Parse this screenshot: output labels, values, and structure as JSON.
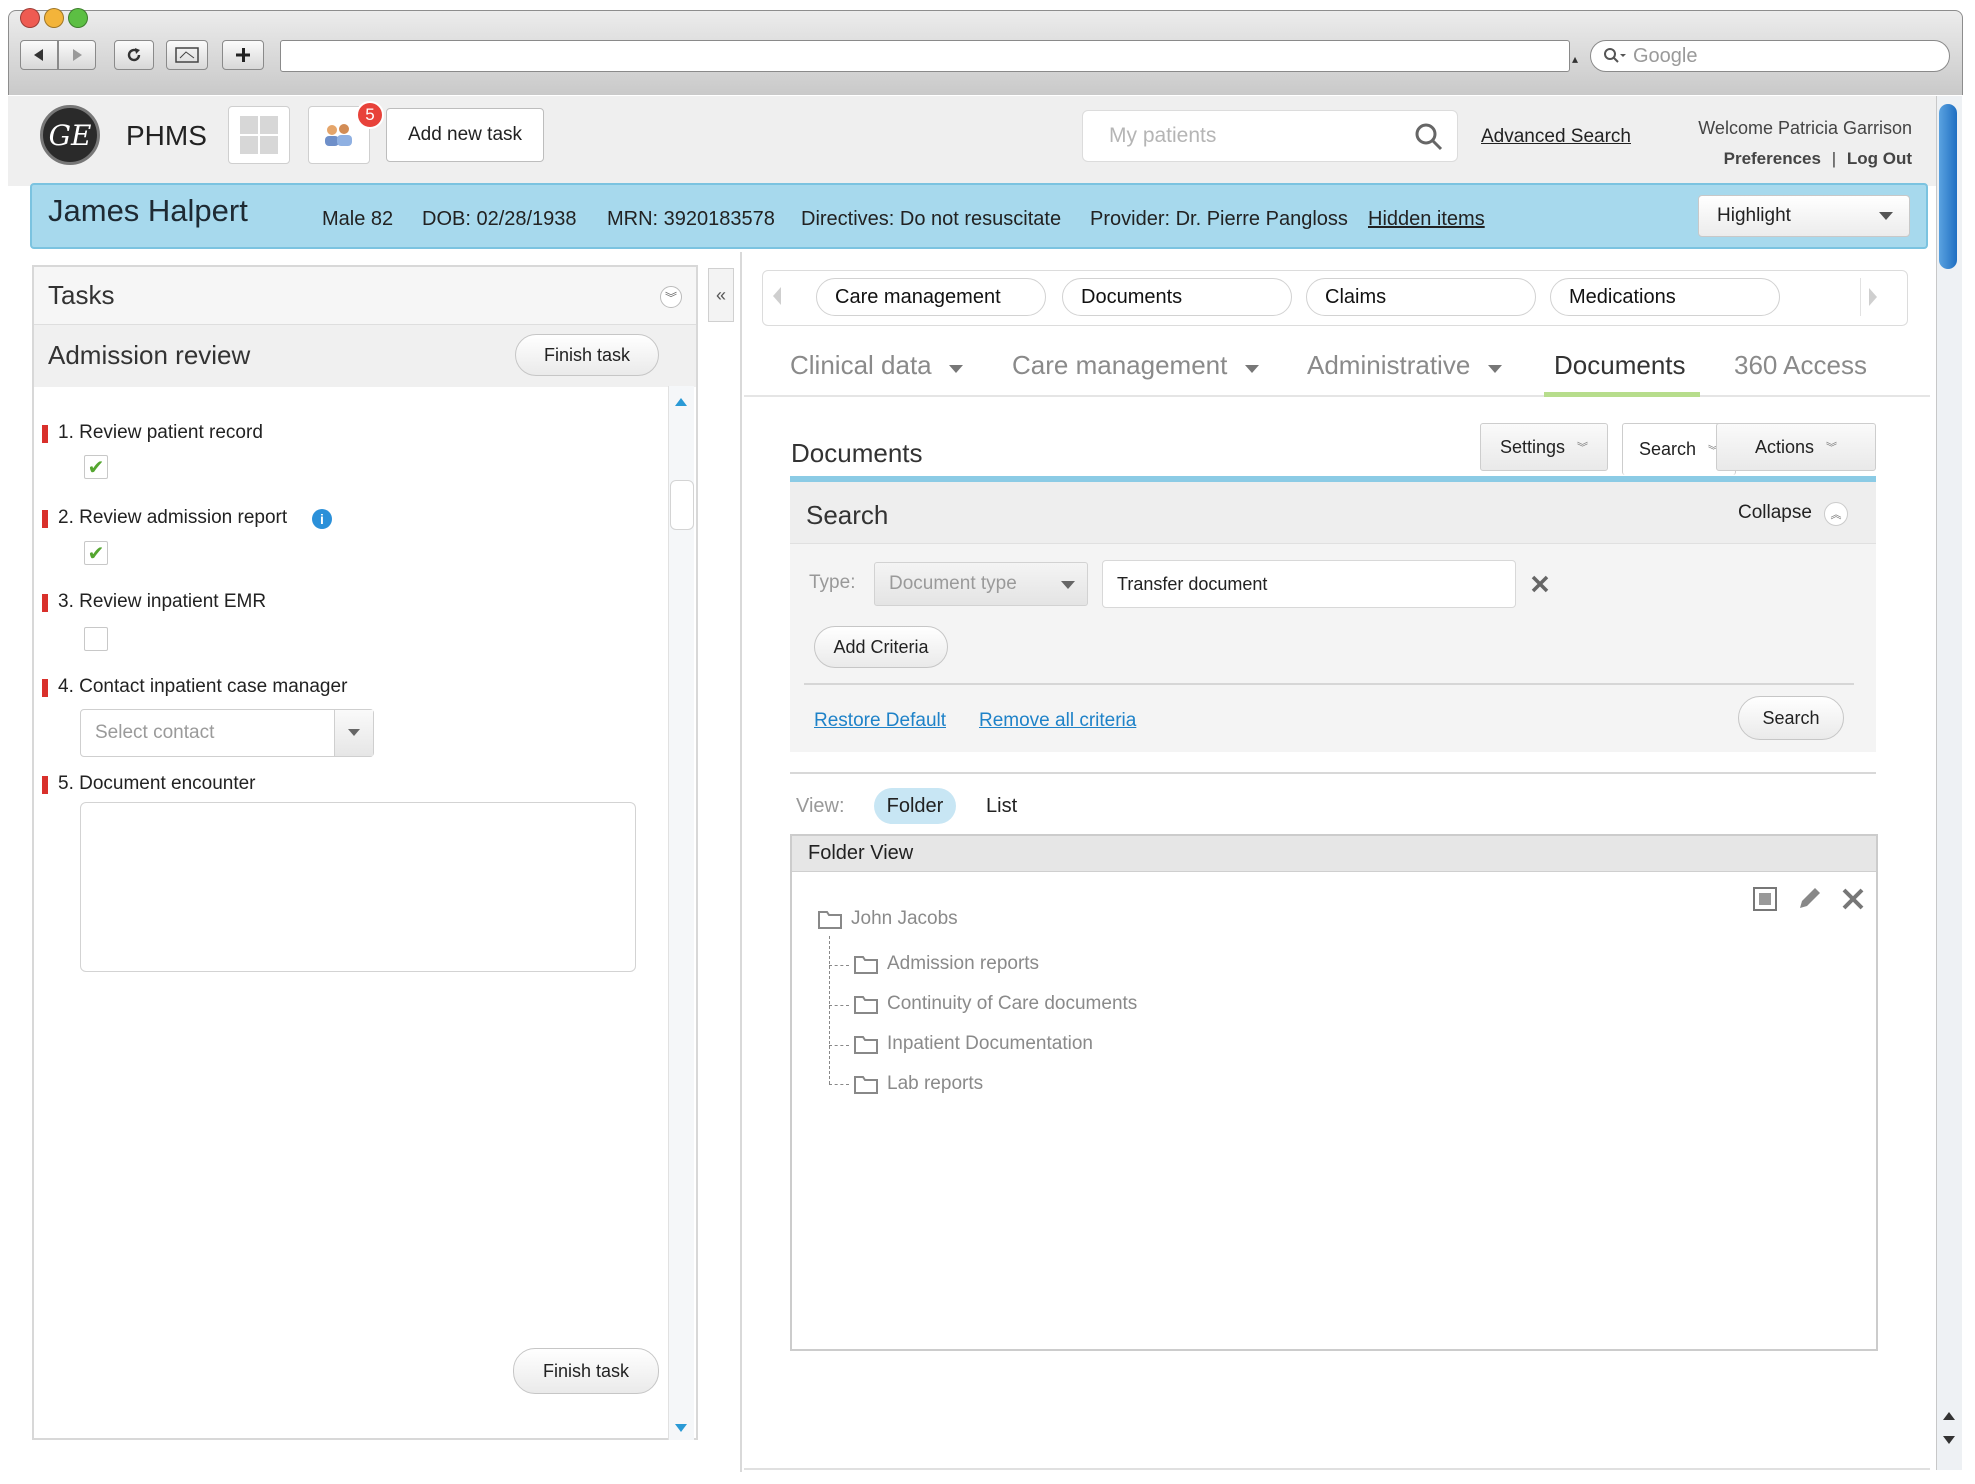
{
  "browser": {
    "search_placeholder": "Google",
    "back_icon": "back-arrow-icon",
    "forward_icon": "forward-arrow-icon",
    "reload_icon": "reload-icon",
    "add_icon": "plus-icon"
  },
  "header": {
    "logo": "GE",
    "app_name": "PHMS",
    "notification_count": "5",
    "add_task_label": "Add new task",
    "search_placeholder": "My patients",
    "advanced_search": "Advanced Search",
    "welcome": "Welcome Patricia Garrison",
    "preferences": "Preferences",
    "separator": "|",
    "logout": "Log Out"
  },
  "patient": {
    "name": "James Halpert",
    "sex_age": "Male 82",
    "dob": "DOB: 02/28/1938",
    "mrn": "MRN: 3920183578",
    "directives": "Directives: Do not resuscitate",
    "provider": "Provider: Dr. Pierre Pangloss",
    "hidden_items": "Hidden items",
    "highlight": "Highlight"
  },
  "tasks": {
    "title": "Tasks",
    "task_name": "Admission review",
    "finish_label": "Finish task",
    "items": [
      {
        "label": "1. Review patient record",
        "checked": true
      },
      {
        "label": "2. Review admission report",
        "checked": true
      },
      {
        "label": "3. Review inpatient EMR",
        "checked": false
      },
      {
        "label": "4. Contact inpatient case manager"
      },
      {
        "label": "5. Document encounter"
      }
    ],
    "contact_placeholder": "Select contact"
  },
  "subtabs": [
    "Care management",
    "Documents",
    "Claims",
    "Medications"
  ],
  "nav": {
    "tabs": [
      {
        "label": "Clinical data",
        "dropdown": true
      },
      {
        "label": "Care management",
        "dropdown": true
      },
      {
        "label": "Administrative",
        "dropdown": true
      },
      {
        "label": "Documents",
        "active": true
      },
      {
        "label": "360 Access"
      }
    ]
  },
  "documents": {
    "title": "Documents",
    "settings": "Settings",
    "search": "Search",
    "actions": "Actions",
    "search_panel": {
      "title": "Search",
      "collapse": "Collapse",
      "type_label": "Type:",
      "type_select": "Document type",
      "type_value": "Transfer document",
      "add_criteria": "Add Criteria",
      "restore_default": "Restore Default",
      "remove_all": "Remove all criteria",
      "search_button": "Search"
    },
    "view": {
      "label": "View:",
      "folder": "Folder",
      "list": "List",
      "active": "Folder"
    },
    "folder_view": {
      "title": "Folder View",
      "root": "John Jacobs",
      "children": [
        "Admission reports",
        "Continuity of Care documents",
        "Inpatient Documentation",
        "Lab reports"
      ]
    }
  },
  "colors": {
    "banner": "#a7d9ed",
    "active_tab_underline": "#b7dd8c",
    "link": "#1e82c8",
    "required_marker": "#d9302b",
    "badge": "#e8423a"
  }
}
